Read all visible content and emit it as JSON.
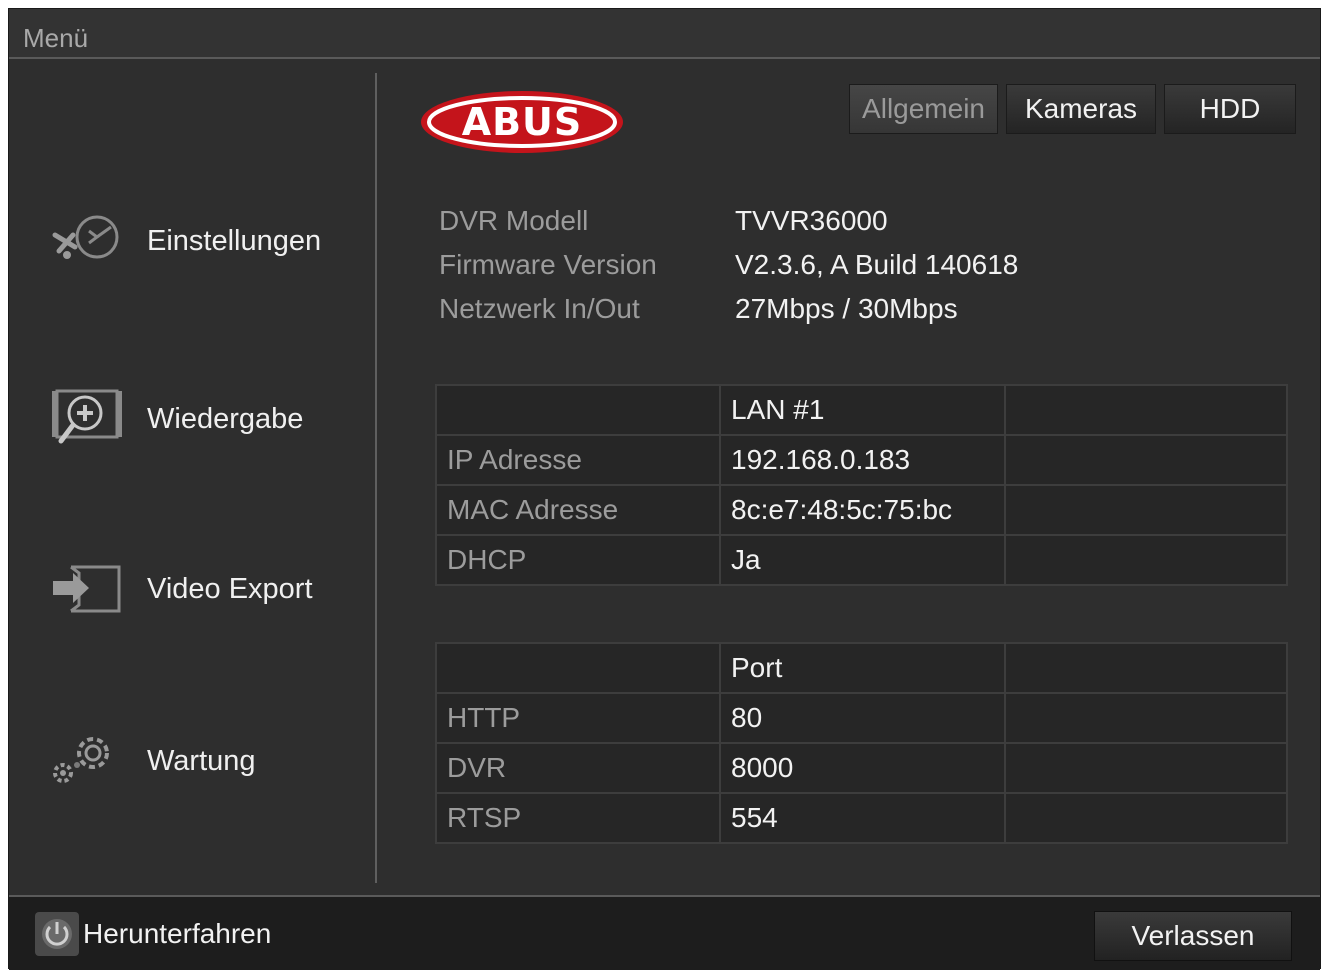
{
  "window": {
    "title": "Menü"
  },
  "logo": {
    "text": "ABUS"
  },
  "sidebar": {
    "items": [
      {
        "label": "Einstellungen",
        "icon": "tools-icon"
      },
      {
        "label": "Wiedergabe",
        "icon": "playback-icon"
      },
      {
        "label": "Video Export",
        "icon": "export-icon"
      },
      {
        "label": "Wartung",
        "icon": "gears-icon"
      }
    ]
  },
  "tabs": [
    {
      "label": "Allgemein",
      "active": true
    },
    {
      "label": "Kameras",
      "active": false
    },
    {
      "label": "HDD",
      "active": false
    }
  ],
  "info": {
    "rows": [
      {
        "key": "DVR Modell",
        "value": "TVVR36000"
      },
      {
        "key": "Firmware Version",
        "value": "V2.3.6, A Build 140618"
      },
      {
        "key": "Netzwerk In/Out",
        "value": "27Mbps / 30Mbps"
      }
    ]
  },
  "network_table": {
    "header": [
      "",
      "LAN #1",
      ""
    ],
    "rows": [
      {
        "key": "IP Adresse",
        "value": "192.168.0.183"
      },
      {
        "key": "MAC Adresse",
        "value": "8c:e7:48:5c:75:bc"
      },
      {
        "key": "DHCP",
        "value": "Ja"
      }
    ]
  },
  "port_table": {
    "header": [
      "",
      "Port",
      ""
    ],
    "rows": [
      {
        "key": "HTTP",
        "value": "80"
      },
      {
        "key": "DVR",
        "value": "8000"
      },
      {
        "key": "RTSP",
        "value": "554"
      }
    ]
  },
  "footer": {
    "shutdown_label": "Herunterfahren",
    "exit_label": "Verlassen"
  },
  "colors": {
    "background": "#2e2e2e",
    "logo_red": "#c4141b",
    "text": "#f2f2f2",
    "muted_text": "#9c9c9c"
  }
}
